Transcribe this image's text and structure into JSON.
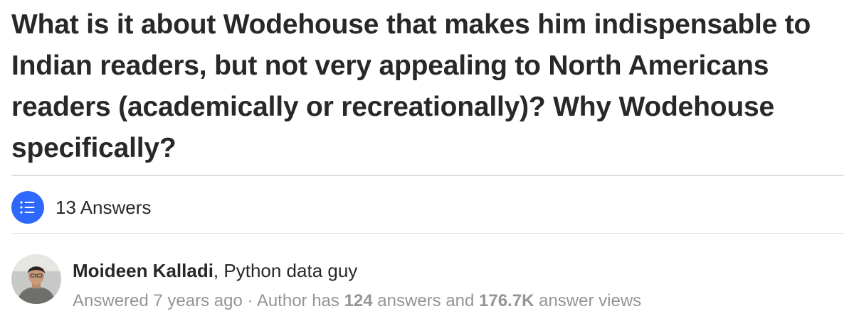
{
  "question": {
    "title": "What is it about Wodehouse that makes him indispensable to Indian readers, but not very appealing to North Americans readers (academically or recreationally)? Why Wodehouse specifically?"
  },
  "answers": {
    "icon": "list-icon",
    "count_label": "13 Answers"
  },
  "author": {
    "avatar_icon": "user-avatar",
    "name": "Moideen Kalladi",
    "separator": ", ",
    "credential": "Python data guy",
    "answered_prefix": "Answered ",
    "answered_time": "7 years ago",
    "dot": " · ",
    "author_has": "Author has ",
    "answer_count": "124",
    "answers_and": " answers and ",
    "view_count": "176.7K",
    "answer_views": " answer views"
  },
  "colors": {
    "accent": "#2e69ff",
    "text": "#282829",
    "muted": "#939598",
    "divider": "#dee0e1"
  }
}
